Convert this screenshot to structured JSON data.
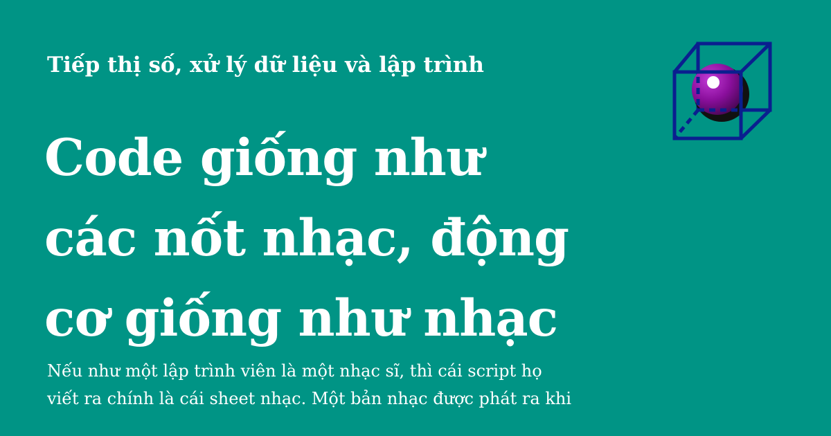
{
  "header": {
    "category": "Tiếp thị số, xử lý dữ liệu và lập trình"
  },
  "article": {
    "title_lines": [
      "Code giống như",
      "các nốt nhạc, động",
      "cơ giống như nhạc"
    ],
    "excerpt_lines": [
      "Nếu như một lập trình viên là một nhạc sĩ, thì cái script họ",
      "viết ra chính là cái sheet nhạc. Một bản nhạc được phát ra khi"
    ]
  },
  "logo": {
    "icon": "cube-with-sphere-icon"
  },
  "colors": {
    "background": "#009485",
    "text": "#ffffff",
    "cube_stroke": "#0a1f8f",
    "sphere": "#8a0f9c"
  }
}
